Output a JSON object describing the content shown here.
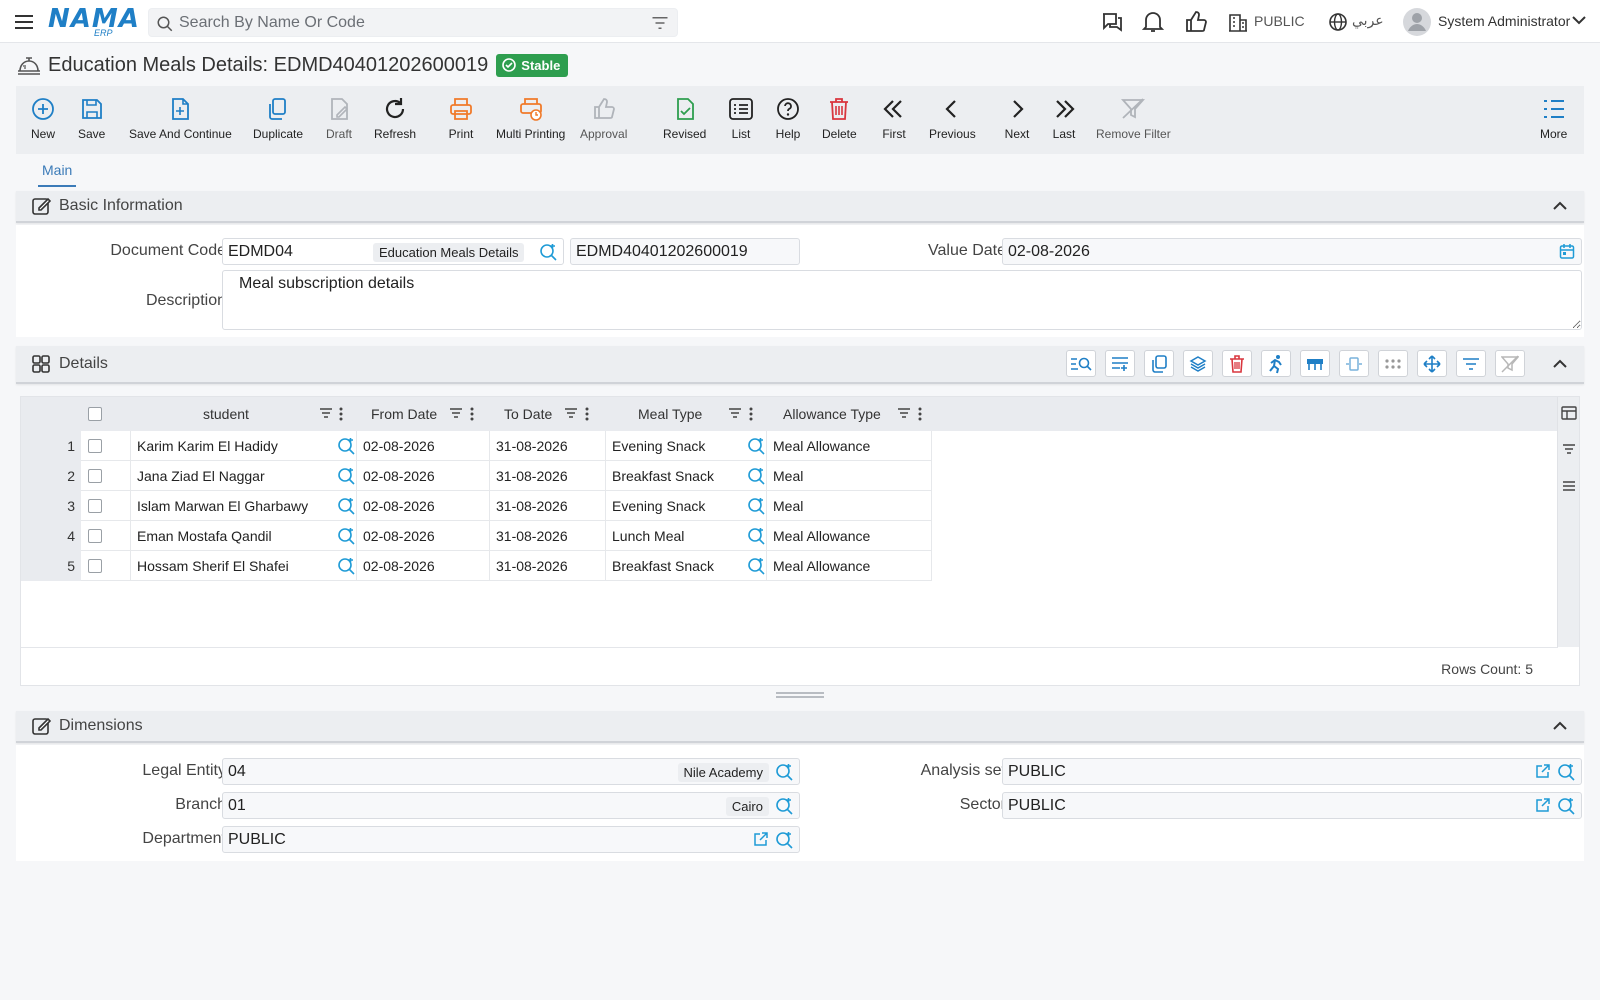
{
  "topbar": {
    "logo_text": "NAMA",
    "logo_sub": "ERP",
    "search_placeholder": "Search By Name Or Code",
    "company": "PUBLIC",
    "language": "عربي",
    "user": "System Administrator"
  },
  "title": {
    "text": "Education Meals Details: EDMD40401202600019",
    "badge": "Stable"
  },
  "toolbar": [
    {
      "label": "New",
      "icon": "plus-circle-icon"
    },
    {
      "label": "Save",
      "icon": "save-icon"
    },
    {
      "label": "Save And Continue",
      "icon": "save-continue-icon"
    },
    {
      "label": "Duplicate",
      "icon": "duplicate-icon"
    },
    {
      "label": "Draft",
      "icon": "draft-icon"
    },
    {
      "label": "Refresh",
      "icon": "refresh-icon"
    },
    {
      "label": "Print",
      "icon": "print-icon"
    },
    {
      "label": "Multi Printing",
      "icon": "multi-print-icon"
    },
    {
      "label": "Approval",
      "icon": "thumbs-up-icon"
    },
    {
      "label": "Revised",
      "icon": "revised-icon"
    },
    {
      "label": "List",
      "icon": "list-icon"
    },
    {
      "label": "Help",
      "icon": "help-icon"
    },
    {
      "label": "Delete",
      "icon": "trash-icon"
    },
    {
      "label": "First",
      "icon": "double-chevron-left-icon"
    },
    {
      "label": "Previous",
      "icon": "chevron-left-icon"
    },
    {
      "label": "Next",
      "icon": "chevron-right-icon"
    },
    {
      "label": "Last",
      "icon": "double-chevron-right-icon"
    },
    {
      "label": "Remove Filter",
      "icon": "remove-filter-icon"
    },
    {
      "label": "More",
      "icon": "more-list-icon"
    }
  ],
  "tabs": {
    "main": "Main"
  },
  "basic": {
    "title": "Basic Information",
    "doc_code_label": "Document Code",
    "doc_code_value": "EDMD04",
    "doc_type_chip": "Education Meals Details",
    "doc_number": "EDMD40401202600019",
    "value_date_label": "Value Date",
    "value_date": "02-08-2026",
    "description_label": "Description",
    "description": "Meal subscription details"
  },
  "details": {
    "title": "Details",
    "columns": [
      "student",
      "From Date",
      "To Date",
      "Meal Type",
      "Allowance Type"
    ],
    "rows": [
      {
        "num": "1",
        "student": "Karim Karim El Hadidy",
        "from": "02-08-2026",
        "to": "31-08-2026",
        "meal": "Evening Snack",
        "allowance": "Meal Allowance"
      },
      {
        "num": "2",
        "student": "Jana Ziad El Naggar",
        "from": "02-08-2026",
        "to": "31-08-2026",
        "meal": "Breakfast Snack",
        "allowance": "Meal"
      },
      {
        "num": "3",
        "student": "Islam Marwan El Gharbawy",
        "from": "02-08-2026",
        "to": "31-08-2026",
        "meal": "Evening Snack",
        "allowance": "Meal"
      },
      {
        "num": "4",
        "student": "Eman Mostafa Qandil",
        "from": "02-08-2026",
        "to": "31-08-2026",
        "meal": "Lunch Meal",
        "allowance": "Meal Allowance"
      },
      {
        "num": "5",
        "student": "Hossam Sherif El Shafei",
        "from": "02-08-2026",
        "to": "31-08-2026",
        "meal": "Breakfast Snack",
        "allowance": "Meal Allowance"
      }
    ],
    "rows_count": "Rows Count: 5"
  },
  "dimensions": {
    "title": "Dimensions",
    "legal_entity_label": "Legal Entity",
    "legal_entity_value": "04",
    "legal_entity_chip": "Nile Academy",
    "branch_label": "Branch",
    "branch_value": "01",
    "branch_chip": "Cairo",
    "department_label": "Department",
    "department_value": "PUBLIC",
    "analysis_label": "Analysis set",
    "analysis_value": "PUBLIC",
    "sector_label": "Sector",
    "sector_value": "PUBLIC"
  },
  "colors": {
    "accent": "#1f7fc6",
    "stable": "#2e9e4f",
    "delete": "#d9363e",
    "print": "#f07a2a",
    "revised": "#2e9e4f"
  }
}
